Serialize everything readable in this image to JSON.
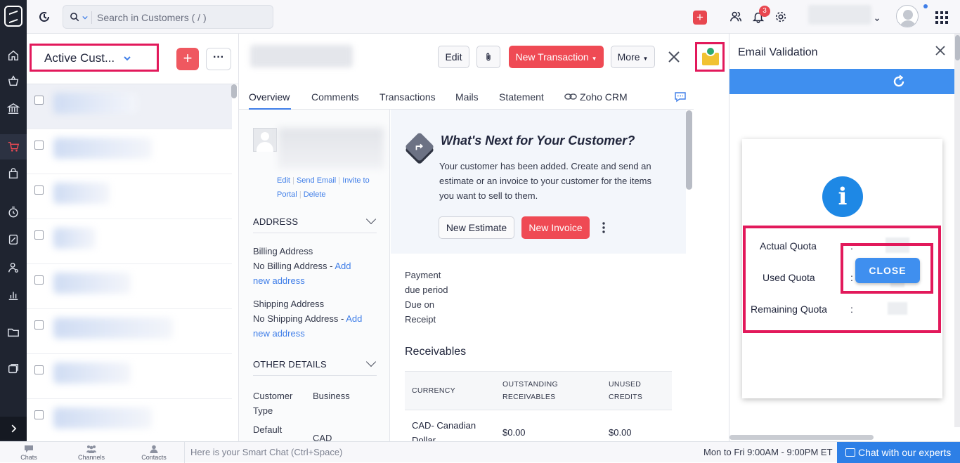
{
  "topbar": {
    "search_placeholder": "Search in Customers ( / )"
  },
  "notifications": {
    "count": "3"
  },
  "list": {
    "view_label": "Active Cust...",
    "rows": 8
  },
  "detail": {
    "actions": {
      "edit": "Edit",
      "new_transaction": "New Transaction",
      "more": "More"
    },
    "tabs": [
      "Overview",
      "Comments",
      "Transactions",
      "Mails",
      "Statement",
      "Zoho CRM"
    ],
    "contact_links": {
      "edit": "Edit",
      "send_email": "Send Email",
      "invite_to": "Invite to",
      "portal": "Portal",
      "delete": "Delete"
    },
    "address": {
      "heading": "ADDRESS",
      "billing_label": "Billing Address",
      "billing_value": "No Billing Address -",
      "billing_add_1": "Add",
      "billing_add_2": "new address",
      "shipping_label": "Shipping Address",
      "shipping_value": "No Shipping Address -",
      "shipping_add_1": "Add",
      "shipping_add_2": "new address"
    },
    "other": {
      "heading": "OTHER DETAILS",
      "customer_type_label_1": "Customer",
      "customer_type_label_2": "Type",
      "customer_type_value": "Business",
      "default_label": "Default",
      "default_value": "CAD"
    },
    "next": {
      "title": "What's Next for Your Customer?",
      "line1": "Your customer has been added. Create and send an",
      "line2": "estimate or an invoice to your customer for the items",
      "line3": "you want to sell to them.",
      "new_estimate": "New Estimate",
      "new_invoice": "New Invoice"
    },
    "payment": {
      "label_1": "Payment",
      "label_2": "due period",
      "value_1": "Due on",
      "value_2": "Receipt"
    },
    "receivables": {
      "title": "Receivables",
      "col_currency": "CURRENCY",
      "col_outstanding_1": "OUTSTANDING",
      "col_outstanding_2": "RECEIVABLES",
      "col_unused_1": "UNUSED",
      "col_unused_2": "CREDITS",
      "row_currency_1": "CAD- Canadian",
      "row_currency_2": "Dollar",
      "row_outstanding": "$0.00",
      "row_unused": "$0.00"
    }
  },
  "email_validation": {
    "title": "Email Validation",
    "actual_quota_label": "Actual Quota",
    "used_quota_label": "Used Quota",
    "remaining_quota_label": "Remaining Quota",
    "colon": ":",
    "close_label": "CLOSE"
  },
  "bottombar": {
    "chats": "Chats",
    "channels": "Channels",
    "contacts": "Contacts",
    "smart_chat_placeholder": "Here is your Smart Chat (Ctrl+Space)",
    "hours": "Mon to Fri 9:00AM - 9:00PM ET",
    "expert": "Chat with our experts"
  },
  "colors": {
    "accent": "#3f8fef",
    "danger": "#ef4a54",
    "highlight": "#e2195b",
    "rail": "#1f2430"
  }
}
